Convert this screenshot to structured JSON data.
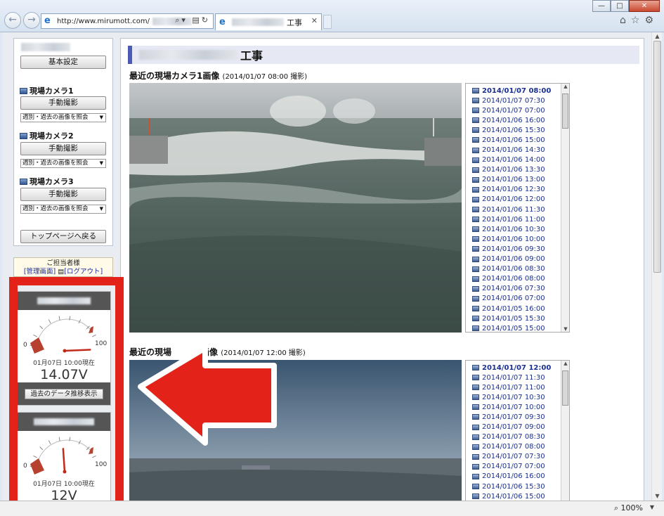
{
  "browser": {
    "url": "http://www.mirumott.com/",
    "tab_title": "工事",
    "zoom": "100%"
  },
  "sidebar": {
    "basic_settings": "基本設定",
    "cameras": [
      {
        "name": "現場カメラ1",
        "capture": "手動撮影",
        "select": "週別・過去の画像を照会"
      },
      {
        "name": "現場カメラ2",
        "capture": "手動撮影",
        "select": "週別・過去の画像を照会"
      },
      {
        "name": "現場カメラ3",
        "capture": "手動撮影",
        "select": "週別・過去の画像を照会"
      }
    ],
    "back_top": "トップページへ戻る",
    "charge": {
      "label": "ご担当者様",
      "admin": "[管理画面]",
      "logout": "[ログアウト]"
    }
  },
  "gauges": [
    {
      "min": "0",
      "max": "100",
      "time": "01月07日  10:00現在",
      "value": "14.07V",
      "button": "過去のデータ推移表示",
      "needle_fraction": 0.92
    },
    {
      "min": "0",
      "max": "100",
      "time": "01月07日  10:00現在",
      "value": "12V",
      "needle_fraction": 0.45
    }
  ],
  "main": {
    "page_title": "工事",
    "sections": [
      {
        "title": "最近の現場カメラ1画像",
        "subtitle": "(2014/01/07 08:00 撮影)",
        "items": [
          "2014/01/07 08:00",
          "2014/01/07 07:30",
          "2014/01/07 07:00",
          "2014/01/06 16:00",
          "2014/01/06 15:30",
          "2014/01/06 15:00",
          "2014/01/06 14:30",
          "2014/01/06 14:00",
          "2014/01/06 13:30",
          "2014/01/06 13:00",
          "2014/01/06 12:30",
          "2014/01/06 12:00",
          "2014/01/06 11:30",
          "2014/01/06 11:00",
          "2014/01/06 10:30",
          "2014/01/06 10:00",
          "2014/01/06 09:30",
          "2014/01/06 09:00",
          "2014/01/06 08:30",
          "2014/01/06 08:00",
          "2014/01/06 07:30",
          "2014/01/06 07:00",
          "2014/01/05 16:00",
          "2014/01/05 15:30",
          "2014/01/05 15:00"
        ]
      },
      {
        "title": "最近の現場",
        "title_tail": "画像",
        "subtitle": "(2014/01/07 12:00 撮影)",
        "items": [
          "2014/01/07 12:00",
          "2014/01/07 11:30",
          "2014/01/07 11:00",
          "2014/01/07 10:30",
          "2014/01/07 10:00",
          "2014/01/07 09:30",
          "2014/01/07 09:00",
          "2014/01/07 08:30",
          "2014/01/07 08:00",
          "2014/01/07 07:30",
          "2014/01/07 07:00",
          "2014/01/06 16:00",
          "2014/01/06 15:30",
          "2014/01/06 15:00"
        ]
      }
    ]
  }
}
